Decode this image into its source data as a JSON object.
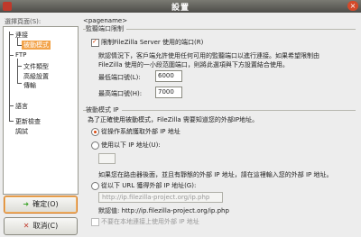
{
  "window": {
    "title": "設置"
  },
  "left": {
    "page_label": "選擇頁面(S):",
    "tree": [
      "連接",
      "被動模式",
      "FTP",
      "文件類型",
      "高級設置",
      "傳輸",
      "語言",
      "更新檢查",
      "調試"
    ],
    "ok_label": "確定(O)",
    "cancel_label": "取消(C)"
  },
  "right": {
    "page_name": "<pagename>",
    "port_section_title": "監聽端口限制",
    "limit_ports_label": "限制FileZilla Server 使用的端口(R)",
    "port_info_line1": "默認情況下，客戶端允許使用任何可用的監聽端口以進行連接。如果希望限制由",
    "port_info_line2": "FileZilla 使用的一小段范圍端口，則將此選項與下方設置結合使用。",
    "lowest_port_label": "最低端口號(L):",
    "lowest_port_value": "6000",
    "highest_port_label": "最高端口號(H):",
    "highest_port_value": "7000",
    "ip_section_title": "被動模式 IP",
    "ip_info": "為了正確使用被動模式，FileZilla 需要知道您的外部IP地址。",
    "opt1_label": "從操作系統獲取外部 IP 地址",
    "opt2_label": "使用以下 IP 地址(U):",
    "opt2_value": "",
    "opt2_hint": "如果您在路由器後面，並且有靜態的外部 IP 地址，請在這裡輸入您的外部 IP 地址。",
    "opt3_label": "從以下 URL 獲得外部 IP 地址(G):",
    "opt3_value": "http://ip.filezilla-project.org/ip.php",
    "default_url": "默認值: http://ip.filezilla-project.org/ip.php",
    "no_external_label": "不要在本地連接上使用外部 IP 地址"
  }
}
